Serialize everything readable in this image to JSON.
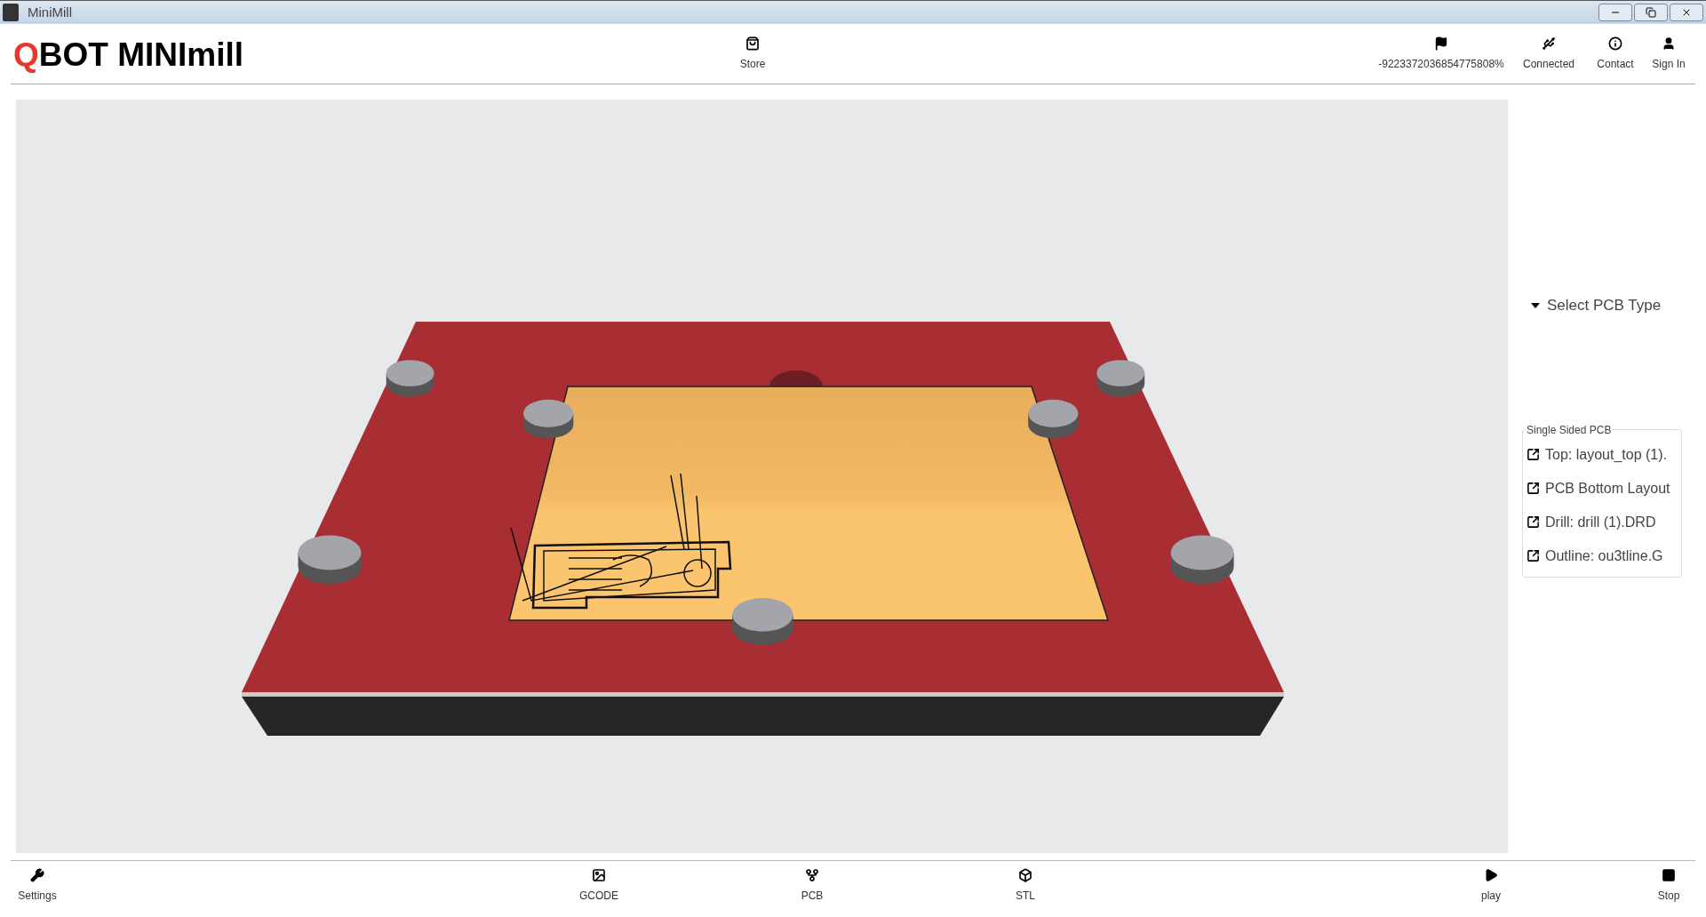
{
  "window": {
    "title": "MiniMill"
  },
  "header": {
    "logo": {
      "accent": "Q",
      "rest": "BOT MINImill"
    },
    "store": {
      "label": "Store"
    },
    "status": [
      {
        "label": "-9223372036854775808%"
      },
      {
        "label": "Connected"
      },
      {
        "label": "Contact"
      },
      {
        "label": "Sign In"
      }
    ]
  },
  "side_panel": {
    "select": {
      "label": "Select PCB Type",
      "expanded": true
    },
    "group": {
      "legend": "Single Sided PCB",
      "files": [
        "Top: layout_top (1).",
        "PCB Bottom Layout",
        "Drill: drill (1).DRD",
        "Outline: ou3tline.G"
      ]
    }
  },
  "toolbar": {
    "left": [
      {
        "label": "Settings"
      }
    ],
    "center": [
      {
        "label": "GCODE"
      },
      {
        "label": "PCB"
      },
      {
        "label": "STL"
      }
    ],
    "right": [
      {
        "label": "play"
      },
      {
        "label": "Stop"
      }
    ]
  }
}
